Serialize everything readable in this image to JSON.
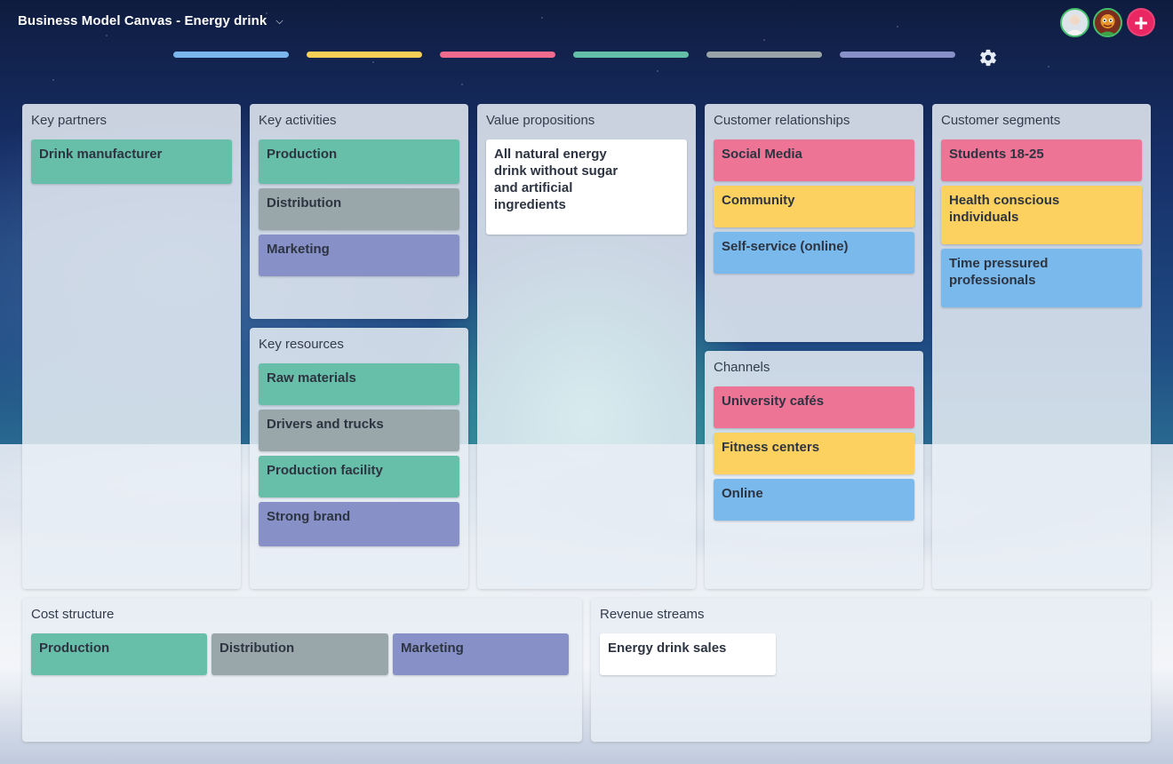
{
  "header": {
    "title": "Business Model Canvas - Energy drink",
    "chevron": "⌄",
    "add_label": "+",
    "color_bars": [
      "#7ab6ec",
      "#f8cf56",
      "#ee6b8d",
      "#62bea7",
      "#9aa4a8",
      "#8791c8"
    ]
  },
  "colors": {
    "green": "#68bfa9",
    "gray": "#9aa7aa",
    "purple": "#8791c8",
    "pink": "#ee7496",
    "yellow": "#fcd15f",
    "blue": "#79b9ec",
    "white": "#ffffff"
  },
  "panels": {
    "key_partners": {
      "title": "Key partners",
      "cards": [
        "Drink manufacturer"
      ]
    },
    "key_activities": {
      "title": "Key activities",
      "cards": [
        "Production",
        "Distribution",
        "Marketing"
      ]
    },
    "key_resources": {
      "title": "Key resources",
      "cards": [
        "Raw materials",
        "Drivers and trucks",
        "Production facility",
        "Strong brand"
      ]
    },
    "value_propositions": {
      "title": "Value propositions",
      "cards": [
        "All natural energy drink without sugar and artificial ingredients"
      ]
    },
    "customer_relationships": {
      "title": "Customer relationships",
      "cards": [
        "Social Media",
        "Community",
        "Self-service (online)"
      ]
    },
    "channels": {
      "title": "Channels",
      "cards": [
        "University cafés",
        "Fitness centers",
        "Online"
      ]
    },
    "customer_segments": {
      "title": "Customer segments",
      "cards": [
        "Students 18-25",
        "Health conscious individuals",
        "Time pressured professionals"
      ]
    },
    "cost_structure": {
      "title": "Cost structure",
      "cards": [
        "Production",
        "Distribution",
        "Marketing"
      ]
    },
    "revenue_streams": {
      "title": "Revenue streams",
      "cards": [
        "Energy drink sales"
      ]
    }
  }
}
